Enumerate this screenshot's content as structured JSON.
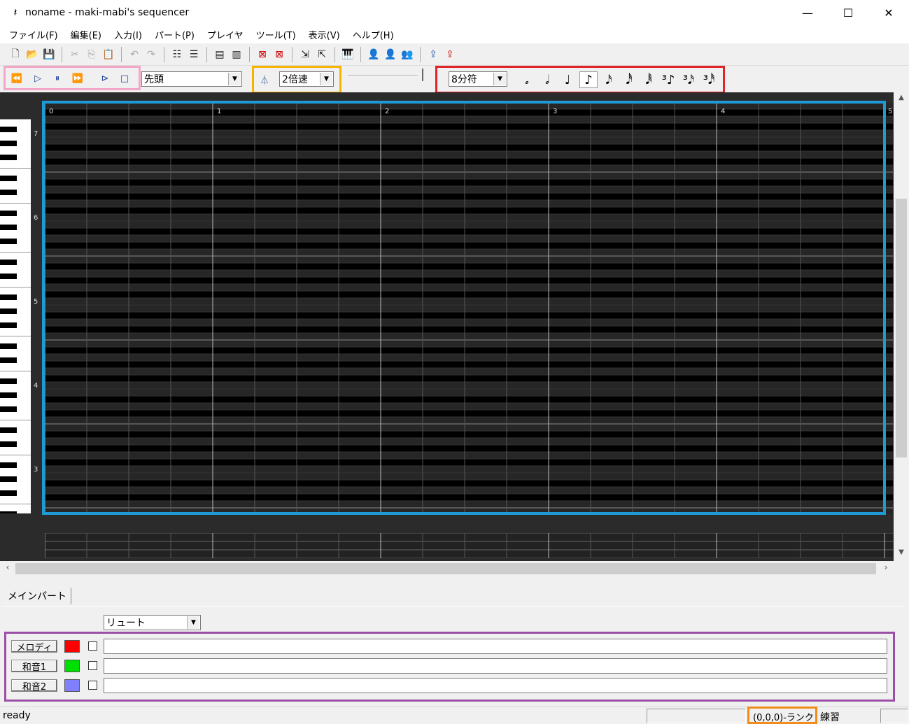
{
  "window": {
    "app_icon": "𝄽",
    "title": "noname - maki-mabi's sequencer",
    "minimize": "—",
    "maximize": "☐",
    "close": "✕"
  },
  "menu": [
    "ファイル(F)",
    "編集(E)",
    "入力(I)",
    "パート(P)",
    "プレイヤ",
    "ツール(T)",
    "表示(V)",
    "ヘルプ(H)"
  ],
  "toolbar1": {
    "icons": [
      "new-file-icon",
      "open-folder-icon",
      "save-icon",
      "cut-icon",
      "copy-icon",
      "paste-icon",
      "undo-icon",
      "redo-icon",
      "insert-measure-icon",
      "insert-measures-icon",
      "insert-track-icon",
      "insert-tracks-icon",
      "delete-measure-icon",
      "delete-measures-icon",
      "import-icon",
      "export-icon",
      "piano-icon",
      "user-add-icon",
      "user-icon",
      "user-settings-icon",
      "upload-icon",
      "upload-red-icon"
    ]
  },
  "transport": {
    "position_select": "先頭",
    "speed_select": "2倍速",
    "note_length_select": "8分符",
    "metronome_icon": "metronome-icon"
  },
  "notes": [
    "𝅗",
    "𝅗𝅥",
    "♩",
    "♪",
    "𝅘𝅥𝅯",
    "𝅘𝅥𝅰",
    "𝅘𝅥𝅱",
    "³♪",
    "³𝅘𝅥𝅯",
    "³𝅘𝅥𝅰"
  ],
  "piano_roll": {
    "bar_labels": [
      "0",
      "1",
      "2",
      "3",
      "4",
      "5"
    ],
    "octave_labels": [
      "7",
      "6",
      "5",
      "4",
      "3"
    ]
  },
  "part_panel": {
    "tab_label": "メインパート",
    "instrument_select": "リュート",
    "rows": [
      {
        "label": "メロディ",
        "color": "#ff0000"
      },
      {
        "label": "和音1",
        "color": "#00e000"
      },
      {
        "label": "和音2",
        "color": "#8080ff"
      }
    ]
  },
  "status": {
    "ready": "ready",
    "position": "(0,0,0)-ランク：",
    "mode": "練習"
  }
}
